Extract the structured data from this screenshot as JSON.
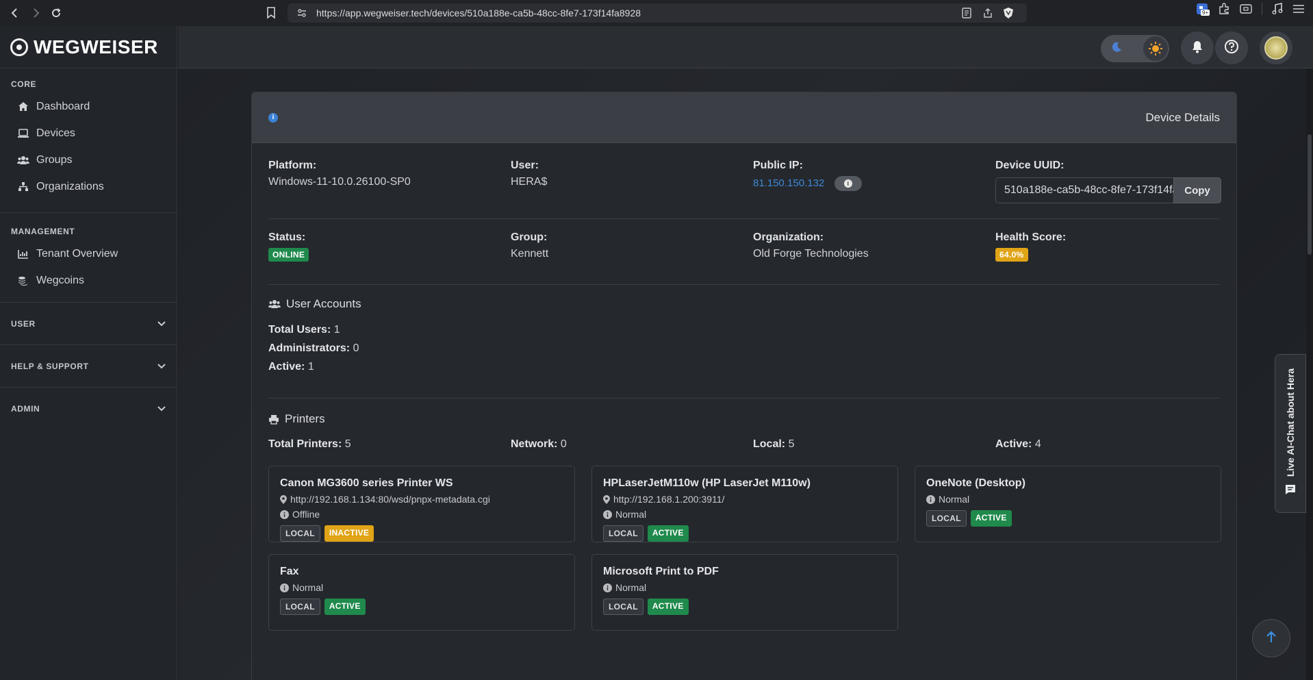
{
  "browser": {
    "url": "https://app.wegweiser.tech/devices/510a188e-ca5b-48cc-8fe7-173f14fa8928",
    "ext_badge": "9+"
  },
  "sidebar": {
    "brand": "WEGWEISER",
    "sections": {
      "core": "CORE",
      "management": "MANAGEMENT",
      "user": "USER",
      "help": "HELP & SUPPORT",
      "admin": "ADMIN"
    },
    "core_items": [
      {
        "label": "Dashboard",
        "icon": "home-icon"
      },
      {
        "label": "Devices",
        "icon": "laptop-icon"
      },
      {
        "label": "Groups",
        "icon": "users-icon"
      },
      {
        "label": "Organizations",
        "icon": "sitemap-icon"
      }
    ],
    "management_items": [
      {
        "label": "Tenant Overview",
        "icon": "chart-icon"
      },
      {
        "label": "Wegcoins",
        "icon": "coins-icon"
      }
    ]
  },
  "card": {
    "title": "Device Details",
    "platform_label": "Platform:",
    "platform": "Windows-11-10.0.26100-SP0",
    "user_label": "User:",
    "user": "HERA$",
    "public_ip_label": "Public IP:",
    "public_ip": "81.150.150.132",
    "uuid_label": "Device UUID:",
    "uuid": "510a188e-ca5b-48cc-8fe7-173f14fa8928",
    "copy_label": "Copy",
    "status_label": "Status:",
    "status": "ONLINE",
    "group_label": "Group:",
    "group": "Kennett",
    "org_label": "Organization:",
    "org": "Old Forge Technologies",
    "health_label": "Health Score:",
    "health": "64.0%"
  },
  "user_accounts": {
    "title": "User Accounts",
    "total_label": "Total Users:",
    "total": "1",
    "admins_label": "Administrators:",
    "admins": "0",
    "active_label": "Active:",
    "active": "1"
  },
  "printers": {
    "title": "Printers",
    "total_label": "Total Printers:",
    "total": "5",
    "network_label": "Network:",
    "network": "0",
    "local_label": "Local:",
    "local": "5",
    "active_label": "Active:",
    "active": "4",
    "items": [
      {
        "name": "Canon MG3600 series Printer WS",
        "location": "http://192.168.1.134:80/wsd/pnpx-metadata.cgi",
        "status": "Offline",
        "type": "LOCAL",
        "state": "INACTIVE"
      },
      {
        "name": "HPLaserJetM110w (HP LaserJet M110w)",
        "location": "http://192.168.1.200:3911/",
        "status": "Normal",
        "type": "LOCAL",
        "state": "ACTIVE"
      },
      {
        "name": "OneNote (Desktop)",
        "status": "Normal",
        "type": "LOCAL",
        "state": "ACTIVE"
      },
      {
        "name": "Fax",
        "status": "Normal",
        "type": "LOCAL",
        "state": "ACTIVE"
      },
      {
        "name": "Microsoft Print to PDF",
        "status": "Normal",
        "type": "LOCAL",
        "state": "ACTIVE"
      }
    ]
  },
  "chat_tab": "Live AI-Chat about Hera",
  "colors": {
    "accent": "#3e8ad8",
    "online": "#1f8a4c",
    "warning": "#e0a416"
  }
}
